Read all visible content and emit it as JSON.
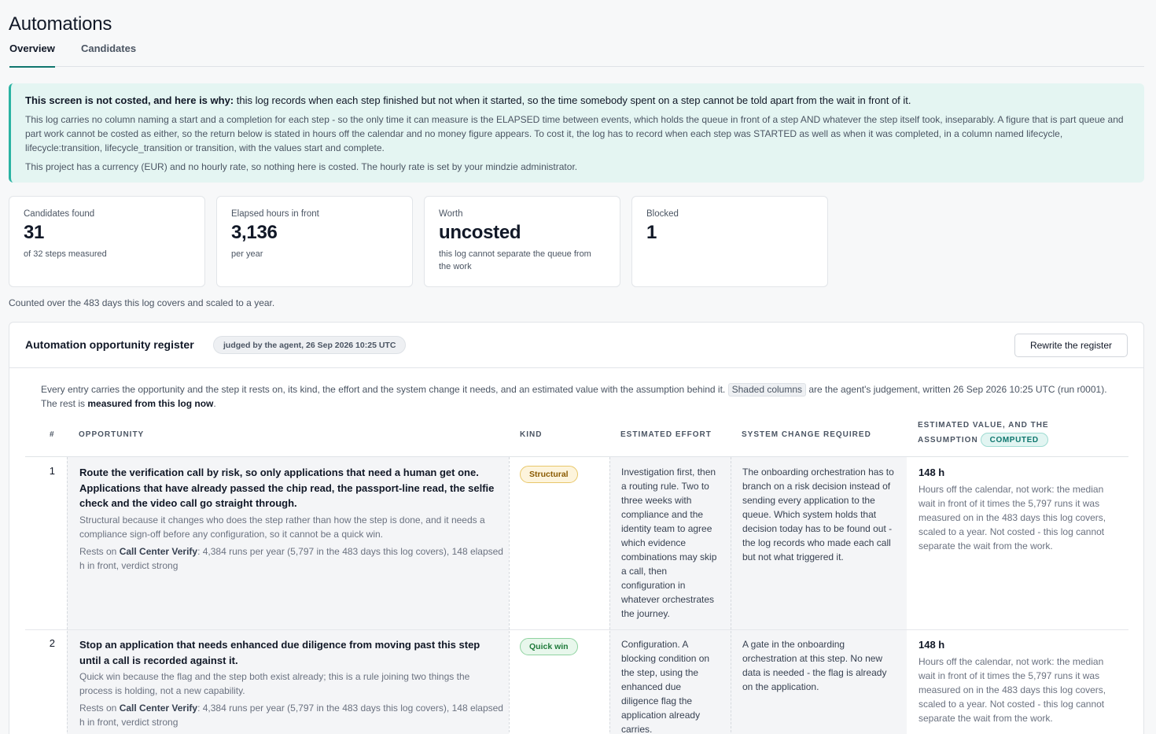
{
  "page": {
    "title": "Automations",
    "tabs": [
      "Overview",
      "Candidates"
    ]
  },
  "notice": {
    "head_bold": "This screen is not costed, and here is why:",
    "head_rest": " this log records when each step finished but not when it started, so the time somebody spent on a step cannot be told apart from the wait in front of it.",
    "body": "This log carries no column naming a start and a completion for each step - so the only time it can measure is the ELAPSED time between events, which holds the queue in front of a step AND whatever the step itself took, inseparably. A figure that is part queue and part work cannot be costed as either, so the return below is stated in hours off the calendar and no money figure appears. To cost it, the log has to record when each step was STARTED as well as when it was completed, in a column named lifecycle, lifecycle:transition, lifecycle_transition or transition, with the values start and complete.",
    "foot": "This project has a currency (EUR) and no hourly rate, so nothing here is costed. The hourly rate is set by your mindzie administrator."
  },
  "stats": [
    {
      "label": "Candidates found",
      "value": "31",
      "sub": "of 32 steps measured"
    },
    {
      "label": "Elapsed hours in front",
      "value": "3,136",
      "sub": "per year"
    },
    {
      "label": "Worth",
      "value": "uncosted",
      "sub": "this log cannot separate the queue from the work"
    },
    {
      "label": "Blocked",
      "value": "1",
      "sub": ""
    }
  ],
  "scale_note": "Counted over the 483 days this log covers and scaled to a year.",
  "register": {
    "title": "Automation opportunity register",
    "badge": "judged by the agent, 26 Sep 2026 10:25 UTC",
    "rewrite_button": "Rewrite the register",
    "intro_1": "Every entry carries the opportunity and the step it rests on, its kind, the effort and the system change it needs, and an estimated value with the assumption behind it.",
    "intro_chip": "Shaded columns",
    "intro_2": " are the agent's judgement, written 26 Sep 2026 10:25 UTC (run r0001). The rest is ",
    "intro_bold": "measured from this log now",
    "intro_end": ".",
    "columns": {
      "num": "#",
      "opportunity": "Opportunity",
      "kind": "Kind",
      "effort": "Estimated effort",
      "system": "System change required",
      "value_line1": "Estimated value, and the",
      "value_line2": "assumption",
      "computed": "COMPUTED"
    },
    "rows": [
      {
        "num": "1",
        "title": "Route the verification call by risk, so only applications that need a human get one. Applications that have already passed the chip read, the passport-line read, the selfie check and the video call go straight through.",
        "why": "Structural because it changes who does the step rather than how the step is done, and it needs a compliance sign-off before any configuration, so it cannot be a quick win.",
        "rests_pre": "Rests on ",
        "rests_step": "Call Center Verify",
        "rests_post": ": 4,384 runs per year (5,797 in the 483 days this log covers), 148 elapsed h in front, verdict strong",
        "kind": "Structural",
        "effort": "Investigation first, then a routing rule. Two to three weeks with compliance and the identity team to agree which evidence combinations may skip a call, then configuration in whatever orchestrates the journey.",
        "system": "The onboarding orchestration has to branch on a risk decision instead of sending every application to the queue. Which system holds that decision today has to be found out - the log records who made each call but not what triggered it.",
        "value_h": "148 h",
        "value_txt": "Hours off the calendar, not work: the median wait in front of it times the 5,797 runs it was measured on in the 483 days this log covers, scaled to a year. Not costed - this log cannot separate the wait from the work."
      },
      {
        "num": "2",
        "title": "Stop an application that needs enhanced due diligence from moving past this step until a call is recorded against it.",
        "why": "Quick win because the flag and the step both exist already; this is a rule joining two things the process is holding, not a new capability.",
        "rests_pre": "Rests on ",
        "rests_step": "Call Center Verify",
        "rests_post": ": 4,384 runs per year (5,797 in the 483 days this log covers), 148 elapsed h in front, verdict strong",
        "kind": "Quick win",
        "effort": "Configuration. A blocking condition on the step, using the enhanced due diligence flag the application already carries.",
        "system": "A gate in the onboarding orchestration at this step. No new data is needed - the flag is already on the application.",
        "value_h": "148 h",
        "value_txt": "Hours off the calendar, not work: the median wait in front of it times the 5,797 runs it was measured on in the 483 days this log covers, scaled to a year. Not costed - this log cannot separate the wait from the work."
      }
    ]
  }
}
